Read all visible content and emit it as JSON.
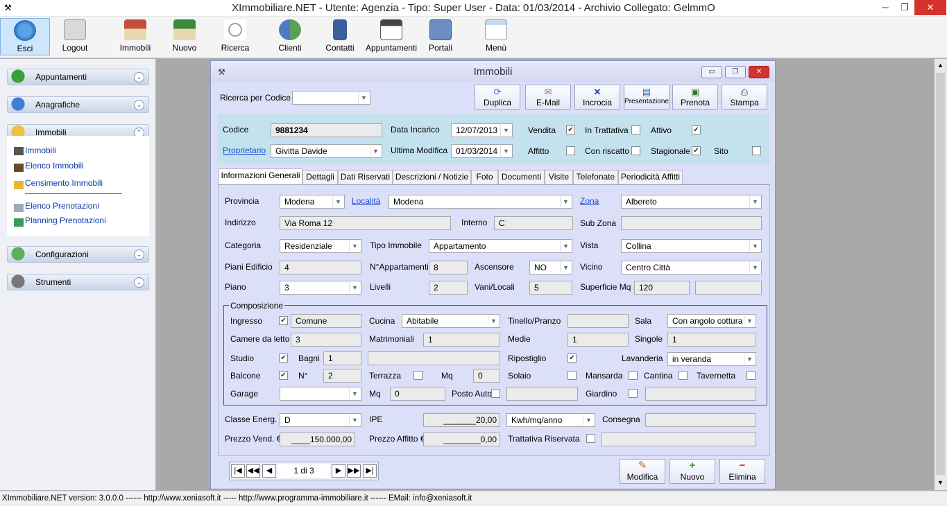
{
  "window_title": "XImmobiliare.NET - Utente: Agenzia - Tipo: Super User - Data: 01/03/2014 - Archivio Collegato: GelmmO",
  "toolbar": {
    "esci": "Esci",
    "logout": "Logout",
    "immobili": "Immobili",
    "nuovo": "Nuovo",
    "ricerca": "Ricerca",
    "clienti": "Clienti",
    "contatti": "Contatti",
    "appuntamenti": "Appuntamenti",
    "portali": "Portali",
    "menu": "Menù"
  },
  "sidebar": {
    "appuntamenti": "Appuntamenti",
    "anagrafiche": "Anagrafiche",
    "immobili": "Immobili",
    "configurazioni": "Configurazioni",
    "strumenti": "Strumenti",
    "items": [
      "Immobili",
      "Elenco Immobili",
      "Censimento Immobili",
      "Elenco Prenotazioni",
      "Planning Prenotazioni"
    ]
  },
  "form": {
    "title": "Immobili",
    "ricerca_label": "Ricerca per Codice",
    "actions": {
      "duplica": "Duplica",
      "email": "E-Mail",
      "incrocia": "Incrocia",
      "presentazione": "Presentazione",
      "prenota": "Prenota",
      "stampa": "Stampa"
    },
    "header": {
      "codice_label": "Codice",
      "codice": "9881234",
      "data_incarico_label": "Data Incarico",
      "data_incarico": "12/07/2013",
      "vendita_label": "Vendita",
      "in_trattativa_label": "In Trattativa",
      "attivo_label": "Attivo",
      "proprietario_label": "Proprietario",
      "proprietario": "Givitta Davide",
      "ultima_modifica_label": "Ultima Modifica",
      "ultima_modifica": "01/03/2014",
      "affitto_label": "Affitto",
      "con_riscatto_label": "Con riscatto",
      "stagionale_label": "Stagionale",
      "sito_label": "Sito"
    },
    "tabs": [
      "Informazioni Generali",
      "Dettagli",
      "Dati Riservati",
      "Descrizioni / Notizie",
      "Foto",
      "Documenti",
      "Visite",
      "Telefonate",
      "Periodicità Affitti"
    ],
    "gen": {
      "provincia_label": "Provincia",
      "provincia": "Modena",
      "localita_label": "Località",
      "localita": "Modena",
      "zona_label": "Zona",
      "zona": "Albereto",
      "indirizzo_label": "Indirizzo",
      "indirizzo": "Via Roma 12",
      "interno_label": "Interno",
      "interno": "C",
      "subzona_label": "Sub Zona",
      "subzona": "",
      "categoria_label": "Categoria",
      "categoria": "Residenziale",
      "tipo_label": "Tipo Immobile",
      "tipo": "Appartamento",
      "vista_label": "Vista",
      "vista": "Collina",
      "piani_label": "Piani Edificio",
      "piani": "4",
      "napp_label": "N°Appartamenti",
      "napp": "8",
      "ascensore_label": "Ascensore",
      "ascensore": "NO",
      "vicino_label": "Vicino",
      "vicino": "Centro Città",
      "piano_label": "Piano",
      "piano": "3",
      "livelli_label": "Livelli",
      "livelli": "2",
      "vani_label": "Vani/Locali",
      "vani": "5",
      "superficie_label": "Superficie Mq",
      "superficie": "120"
    },
    "comp": {
      "legend": "Composizione",
      "ingresso_label": "Ingresso",
      "ingresso": "Comune",
      "cucina_label": "Cucina",
      "cucina": "Abitabile",
      "tinello_label": "Tinello/Pranzo",
      "sala_label": "Sala",
      "sala": "Con angolo cottura",
      "camere_label": "Camere da letto",
      "camere": "3",
      "matrimoniali_label": "Matrimoniali",
      "matrimoniali": "1",
      "medie_label": "Medie",
      "medie": "1",
      "singole_label": "Singole",
      "singole": "1",
      "studio_label": "Studio",
      "bagni_label": "Bagni",
      "bagni": "1",
      "ripostiglio_label": "Ripostiglio",
      "lavanderia_label": "Lavanderia",
      "lavanderia": "in veranda",
      "balcone_label": "Balcone",
      "n_label": "N°",
      "n": "2",
      "terrazza_label": "Terrazza",
      "mq_label": "Mq",
      "mq_terrazza": "0",
      "solaio_label": "Solaio",
      "mansarda_label": "Mansarda",
      "cantina_label": "Cantina",
      "tavernetta_label": "Tavernetta",
      "garage_label": "Garage",
      "mq_garage": "0",
      "posto_auto_label": "Posto Auto",
      "giardino_label": "Giardino"
    },
    "bottom": {
      "classe_label": "Classe Energ.",
      "classe": "D",
      "ipe_label": "IPE",
      "ipe": "_______20,00",
      "ipe_unit": "Kwh/mq/anno",
      "consegna_label": "Consegna",
      "prezzo_vend_label": "Prezzo Vend. €",
      "prezzo_vend": "____150.000,00",
      "prezzo_affitto_label": "Prezzo Affitto €",
      "prezzo_affitto": "________0,00",
      "trattativa_label": "Trattativa Riservata"
    },
    "nav": {
      "record": "1 di 3",
      "first": "|◀",
      "prevpage": "◀◀",
      "prev": "◀",
      "next": "▶",
      "nextpage": "▶▶",
      "last": "▶|"
    },
    "buttons": {
      "modifica": "Modifica",
      "nuovo": "Nuovo",
      "elimina": "Elimina"
    }
  },
  "status": "XImmobiliare.NET version: 3.0.0.0 ------ http://www.xeniasoft.it ----- http://www.programma-immobiliare.it ------ EMail: info@xeniasoft.it",
  "colors": {
    "window_bg": "#dcdff8",
    "header_bg": "#c4e2ee",
    "tab_panel_bg": "#dcdff8",
    "close_red": "#d4322c"
  }
}
